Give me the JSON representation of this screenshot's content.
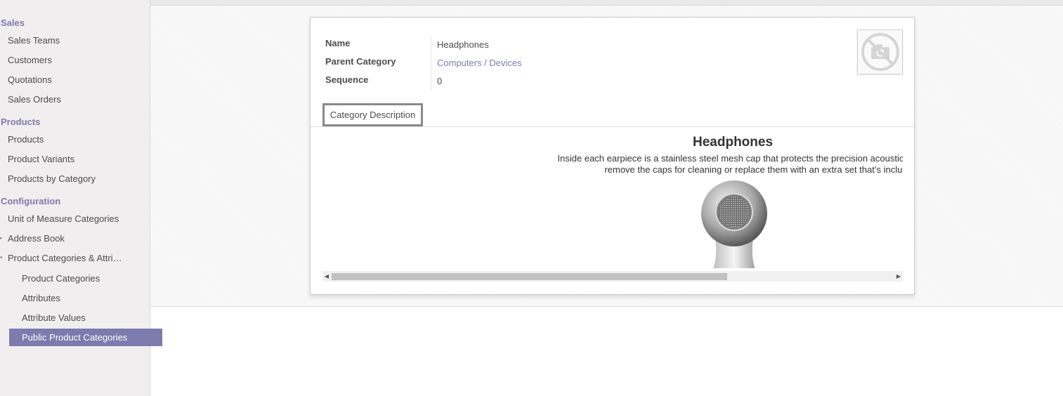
{
  "sidebar": {
    "sections": [
      {
        "title": "Sales",
        "items": [
          "Sales Teams",
          "Customers",
          "Quotations",
          "Sales Orders"
        ]
      },
      {
        "title": "Products",
        "items": [
          "Products",
          "Product Variants",
          "Products by Category"
        ]
      },
      {
        "title": "Configuration",
        "items": [
          "Unit of Measure Categories",
          "Address Book",
          "Product Categories & Attri…"
        ]
      }
    ],
    "sub_items": [
      "Product Categories",
      "Attributes",
      "Attribute Values",
      "Public Product Categories"
    ],
    "accent_color": "#7c7bad"
  },
  "form": {
    "fields": {
      "name_label": "Name",
      "name_value": "Headphones",
      "parent_label": "Parent Category",
      "parent_value": "Computers / Devices",
      "sequence_label": "Sequence",
      "sequence_value": "0"
    },
    "photo_icon": "no-photo-camera-icon",
    "tab_label": "Category Description",
    "description": {
      "title": "Headphones",
      "line1": "Inside each earpiece is a stainless steel mesh cap that protects the precision acoustic components from du",
      "line2": "remove the caps for cleaning or replace them with an extra set that’s included in the bo"
    }
  }
}
